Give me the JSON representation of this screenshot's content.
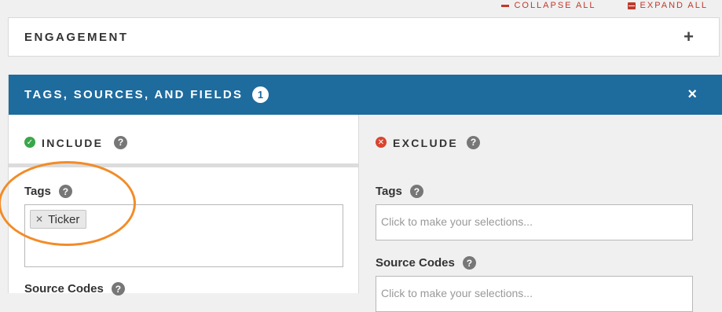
{
  "toolbar": {
    "collapse_all": "COLLAPSE ALL",
    "expand_all": "EXPAND ALL",
    "accent_color": "#c0392b"
  },
  "engagement_panel": {
    "title": "ENGAGEMENT",
    "toggle_icon": "plus-icon"
  },
  "tags_panel": {
    "title": "TAGS, SOURCES, AND FIELDS",
    "badge_count": "1",
    "header_color": "#1e6b9e",
    "include": {
      "label": "INCLUDE",
      "status_icon": "check-circle-icon",
      "status_color": "#3aa64a",
      "tags_label": "Tags",
      "tags_selected": [
        "Ticker"
      ],
      "source_codes_label": "Source Codes"
    },
    "exclude": {
      "label": "EXCLUDE",
      "status_icon": "x-circle-icon",
      "status_color": "#d9442e",
      "tags_label": "Tags",
      "tags_placeholder": "Click to make your selections...",
      "source_codes_label": "Source Codes",
      "source_codes_placeholder": "Click to make your selections..."
    }
  },
  "annotation_color": "#f28c28"
}
